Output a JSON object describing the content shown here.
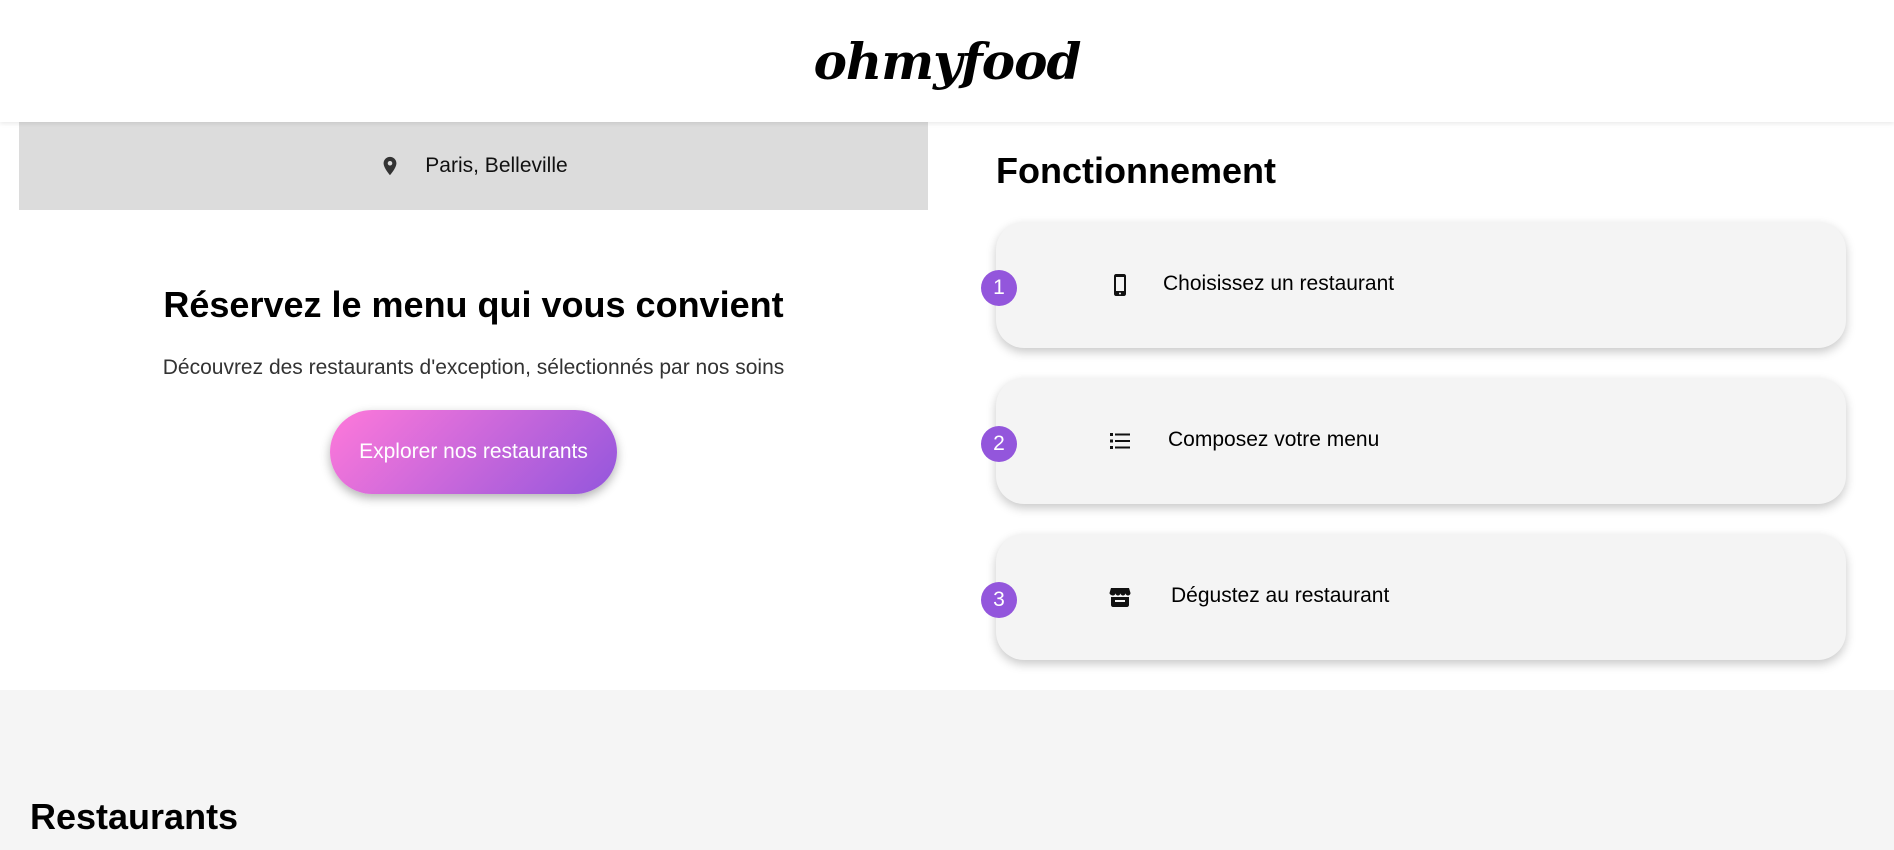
{
  "header": {
    "logo": "ohmyfood"
  },
  "location": {
    "icon": "map-pin-icon",
    "text": "Paris, Belleville"
  },
  "hero": {
    "title": "Réservez le menu qui vous convient",
    "subtitle": "Découvrez des restaurants d'exception, sélectionnés par nos soins",
    "cta_label": "Explorer nos restaurants"
  },
  "how": {
    "title": "Fonctionnement",
    "steps": [
      {
        "number": "1",
        "icon": "mobile-phone-icon",
        "label": "Choisissez un restaurant"
      },
      {
        "number": "2",
        "icon": "list-icon",
        "label": "Composez votre menu"
      },
      {
        "number": "3",
        "icon": "store-icon",
        "label": "Dégustez au restaurant"
      }
    ]
  },
  "restaurants": {
    "title": "Restaurants"
  },
  "colors": {
    "accent_purple": "#9356dc",
    "accent_pink": "#ff79da",
    "card_bg": "#f4f4f4",
    "location_bg": "#dcdcdc"
  }
}
